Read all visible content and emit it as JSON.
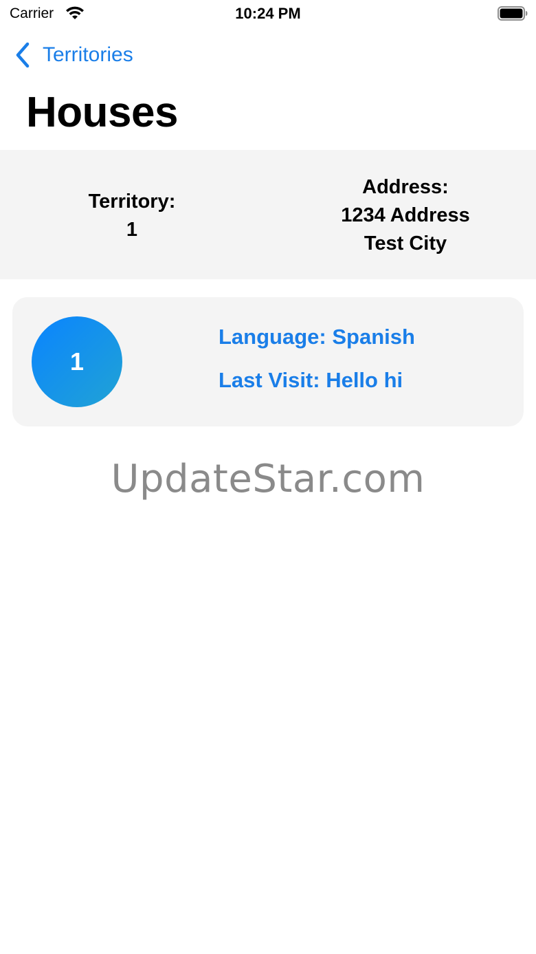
{
  "status_bar": {
    "carrier": "Carrier",
    "time": "10:24 PM"
  },
  "nav": {
    "back_label": "Territories",
    "title": "Houses"
  },
  "territory_info": {
    "territory_label": "Territory:",
    "territory_value": "1",
    "address_label": "Address:",
    "address_line1": "1234 Address",
    "address_line2": "Test City"
  },
  "houses": [
    {
      "number": "1",
      "language": "Language: Spanish",
      "last_visit": "Last Visit: Hello hi"
    }
  ],
  "watermark": "UpdateStar.com",
  "colors": {
    "accent": "#1a7ee8",
    "panel_background": "#f4f4f4",
    "badge_gradient_start": "#0a84ff",
    "badge_gradient_end": "#21a3d4"
  }
}
